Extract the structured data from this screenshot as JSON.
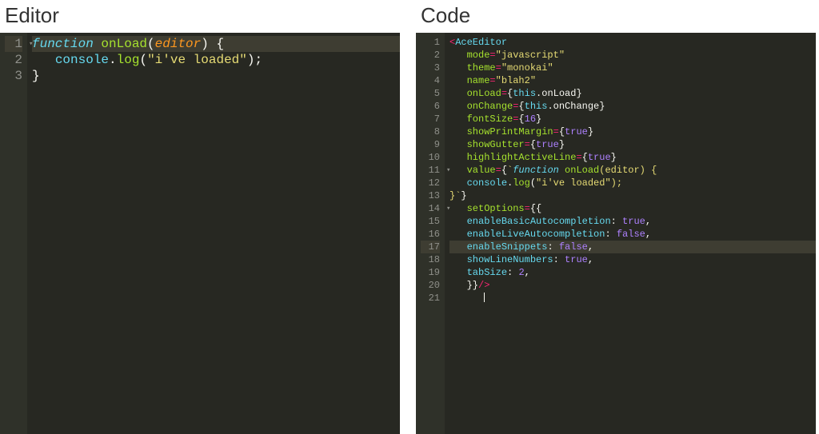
{
  "panes": {
    "left": {
      "title": "Editor"
    },
    "right": {
      "title": "Code"
    }
  },
  "leftEditor": {
    "fontSize": 16,
    "activeLine": 1,
    "lines": [
      {
        "n": 1,
        "fold": true,
        "tokens": [
          {
            "t": "function",
            "c": "kw"
          },
          {
            "t": " ",
            "c": "pn"
          },
          {
            "t": "onLoad",
            "c": "fn"
          },
          {
            "t": "(",
            "c": "pn"
          },
          {
            "t": "editor",
            "c": "pr"
          },
          {
            "t": ") {",
            "c": "pn"
          }
        ]
      },
      {
        "n": 2,
        "tokens": [
          {
            "t": "   ",
            "c": "pn"
          },
          {
            "t": "console",
            "c": "obj"
          },
          {
            "t": ".",
            "c": "pn"
          },
          {
            "t": "log",
            "c": "fn"
          },
          {
            "t": "(",
            "c": "pn"
          },
          {
            "t": "\"i've loaded\"",
            "c": "str"
          },
          {
            "t": ");",
            "c": "pn"
          }
        ]
      },
      {
        "n": 3,
        "tokens": [
          {
            "t": "}",
            "c": "pn"
          }
        ]
      }
    ]
  },
  "rightEditor": {
    "fontSize": 12,
    "activeLine": 17,
    "lines": [
      {
        "n": 1,
        "tokens": [
          {
            "t": "<",
            "c": "tag"
          },
          {
            "t": "AceEditor",
            "c": "obj"
          }
        ]
      },
      {
        "n": 2,
        "tokens": [
          {
            "t": "   ",
            "c": "pn"
          },
          {
            "t": "mode",
            "c": "fn"
          },
          {
            "t": "=",
            "c": "op"
          },
          {
            "t": "\"javascript\"",
            "c": "str"
          }
        ]
      },
      {
        "n": 3,
        "tokens": [
          {
            "t": "   ",
            "c": "pn"
          },
          {
            "t": "theme",
            "c": "fn"
          },
          {
            "t": "=",
            "c": "op"
          },
          {
            "t": "\"monokai\"",
            "c": "str"
          }
        ]
      },
      {
        "n": 4,
        "tokens": [
          {
            "t": "   ",
            "c": "pn"
          },
          {
            "t": "name",
            "c": "fn"
          },
          {
            "t": "=",
            "c": "op"
          },
          {
            "t": "\"blah2\"",
            "c": "str"
          }
        ]
      },
      {
        "n": 5,
        "tokens": [
          {
            "t": "   ",
            "c": "pn"
          },
          {
            "t": "onLoad",
            "c": "fn"
          },
          {
            "t": "=",
            "c": "op"
          },
          {
            "t": "{",
            "c": "pn"
          },
          {
            "t": "this",
            "c": "obj"
          },
          {
            "t": ".",
            "c": "pn"
          },
          {
            "t": "onLoad",
            "c": "pn"
          },
          {
            "t": "}",
            "c": "pn"
          }
        ]
      },
      {
        "n": 6,
        "tokens": [
          {
            "t": "   ",
            "c": "pn"
          },
          {
            "t": "onChange",
            "c": "fn"
          },
          {
            "t": "=",
            "c": "op"
          },
          {
            "t": "{",
            "c": "pn"
          },
          {
            "t": "this",
            "c": "obj"
          },
          {
            "t": ".",
            "c": "pn"
          },
          {
            "t": "onChange",
            "c": "pn"
          },
          {
            "t": "}",
            "c": "pn"
          }
        ]
      },
      {
        "n": 7,
        "tokens": [
          {
            "t": "   ",
            "c": "pn"
          },
          {
            "t": "fontSize",
            "c": "fn"
          },
          {
            "t": "=",
            "c": "op"
          },
          {
            "t": "{",
            "c": "pn"
          },
          {
            "t": "16",
            "c": "num"
          },
          {
            "t": "}",
            "c": "pn"
          }
        ]
      },
      {
        "n": 8,
        "tokens": [
          {
            "t": "   ",
            "c": "pn"
          },
          {
            "t": "showPrintMargin",
            "c": "fn"
          },
          {
            "t": "=",
            "c": "op"
          },
          {
            "t": "{",
            "c": "pn"
          },
          {
            "t": "true",
            "c": "num"
          },
          {
            "t": "}",
            "c": "pn"
          }
        ]
      },
      {
        "n": 9,
        "tokens": [
          {
            "t": "   ",
            "c": "pn"
          },
          {
            "t": "showGutter",
            "c": "fn"
          },
          {
            "t": "=",
            "c": "op"
          },
          {
            "t": "{",
            "c": "pn"
          },
          {
            "t": "true",
            "c": "num"
          },
          {
            "t": "}",
            "c": "pn"
          }
        ]
      },
      {
        "n": 10,
        "tokens": [
          {
            "t": "   ",
            "c": "pn"
          },
          {
            "t": "highlightActiveLine",
            "c": "fn"
          },
          {
            "t": "=",
            "c": "op"
          },
          {
            "t": "{",
            "c": "pn"
          },
          {
            "t": "true",
            "c": "num"
          },
          {
            "t": "}",
            "c": "pn"
          }
        ]
      },
      {
        "n": 11,
        "fold": true,
        "tokens": [
          {
            "t": "   ",
            "c": "pn"
          },
          {
            "t": "value",
            "c": "fn"
          },
          {
            "t": "=",
            "c": "op"
          },
          {
            "t": "{",
            "c": "pn"
          },
          {
            "t": "`",
            "c": "tpl"
          },
          {
            "t": "function",
            "c": "kw"
          },
          {
            "t": " ",
            "c": "pn"
          },
          {
            "t": "onLoad",
            "c": "fn"
          },
          {
            "t": "(editor) {",
            "c": "tpl"
          }
        ]
      },
      {
        "n": 12,
        "tokens": [
          {
            "t": "   ",
            "c": "pn"
          },
          {
            "t": "console",
            "c": "obj"
          },
          {
            "t": ".",
            "c": "pn"
          },
          {
            "t": "log",
            "c": "fn"
          },
          {
            "t": "(",
            "c": "pn"
          },
          {
            "t": "\"i've loaded\"",
            "c": "str"
          },
          {
            "t": ");",
            "c": "tpl"
          }
        ]
      },
      {
        "n": 13,
        "tokens": [
          {
            "t": "}",
            "c": "tpl"
          },
          {
            "t": "`",
            "c": "tpl"
          },
          {
            "t": "}",
            "c": "pn"
          }
        ]
      },
      {
        "n": 14,
        "fold": true,
        "tokens": [
          {
            "t": "   ",
            "c": "pn"
          },
          {
            "t": "setOptions",
            "c": "fn"
          },
          {
            "t": "=",
            "c": "op"
          },
          {
            "t": "{{",
            "c": "pn"
          }
        ]
      },
      {
        "n": 15,
        "tokens": [
          {
            "t": "   ",
            "c": "pn"
          },
          {
            "t": "enableBasicAutocompletion",
            "c": "obj"
          },
          {
            "t": ": ",
            "c": "pn"
          },
          {
            "t": "true",
            "c": "num"
          },
          {
            "t": ",",
            "c": "pn"
          }
        ]
      },
      {
        "n": 16,
        "tokens": [
          {
            "t": "   ",
            "c": "pn"
          },
          {
            "t": "enableLiveAutocompletion",
            "c": "obj"
          },
          {
            "t": ": ",
            "c": "pn"
          },
          {
            "t": "false",
            "c": "num"
          },
          {
            "t": ",",
            "c": "pn"
          }
        ]
      },
      {
        "n": 17,
        "tokens": [
          {
            "t": "   ",
            "c": "pn"
          },
          {
            "t": "enableSnippets",
            "c": "obj"
          },
          {
            "t": ": ",
            "c": "pn"
          },
          {
            "t": "false",
            "c": "num"
          },
          {
            "t": ",",
            "c": "pn"
          }
        ]
      },
      {
        "n": 18,
        "tokens": [
          {
            "t": "   ",
            "c": "pn"
          },
          {
            "t": "showLineNumbers",
            "c": "obj"
          },
          {
            "t": ": ",
            "c": "pn"
          },
          {
            "t": "true",
            "c": "num"
          },
          {
            "t": ",",
            "c": "pn"
          }
        ]
      },
      {
        "n": 19,
        "tokens": [
          {
            "t": "   ",
            "c": "pn"
          },
          {
            "t": "tabSize",
            "c": "obj"
          },
          {
            "t": ": ",
            "c": "pn"
          },
          {
            "t": "2",
            "c": "num"
          },
          {
            "t": ",",
            "c": "pn"
          }
        ]
      },
      {
        "n": 20,
        "tokens": [
          {
            "t": "   }}",
            "c": "pn"
          },
          {
            "t": "/>",
            "c": "tag"
          }
        ]
      },
      {
        "n": 21,
        "tokens": [
          {
            "t": "      ",
            "c": "pn"
          }
        ],
        "cursor": true
      }
    ]
  }
}
